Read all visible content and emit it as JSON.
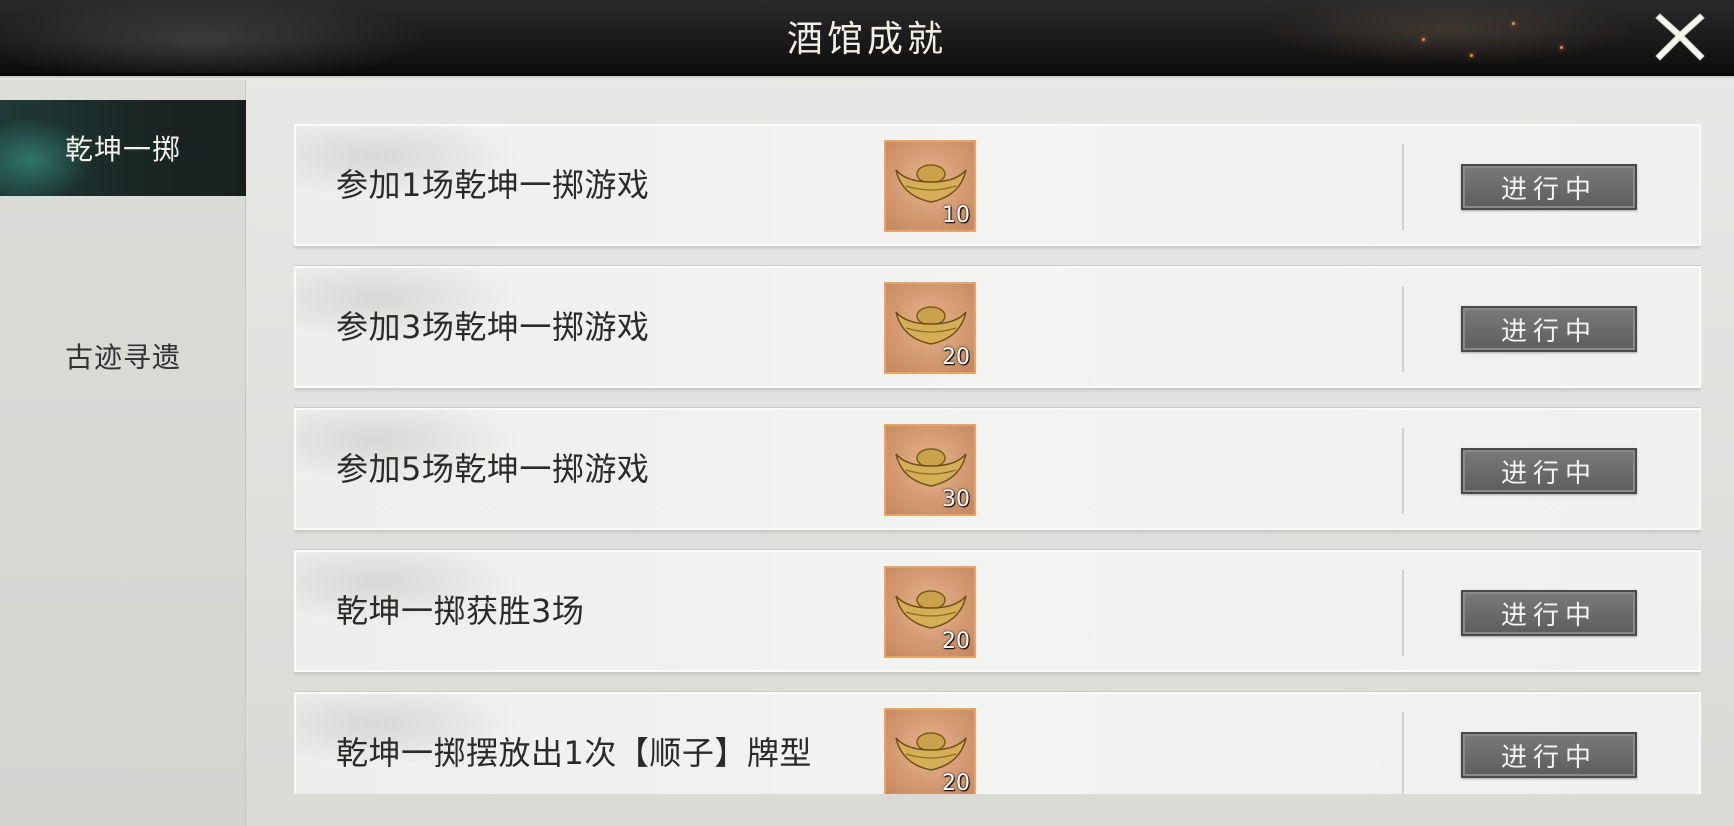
{
  "title": "酒馆成就",
  "close_icon": "close-x-icon",
  "sidebar": {
    "tabs": [
      {
        "label": "乾坤一掷",
        "active": true
      },
      {
        "label": "古迹寻遗",
        "active": false
      }
    ]
  },
  "accent_color": "#1f3a36",
  "achievements": [
    {
      "label": "参加1场乾坤一掷游戏",
      "reward_icon": "gold-ingot-icon",
      "reward_count": "10",
      "status": "进行中"
    },
    {
      "label": "参加3场乾坤一掷游戏",
      "reward_icon": "gold-ingot-icon",
      "reward_count": "20",
      "status": "进行中"
    },
    {
      "label": "参加5场乾坤一掷游戏",
      "reward_icon": "gold-ingot-icon",
      "reward_count": "30",
      "status": "进行中"
    },
    {
      "label": "乾坤一掷获胜3场",
      "reward_icon": "gold-ingot-icon",
      "reward_count": "20",
      "status": "进行中"
    },
    {
      "label": "乾坤一掷摆放出1次【顺子】牌型",
      "reward_icon": "gold-ingot-icon",
      "reward_count": "20",
      "status": "进行中"
    }
  ]
}
